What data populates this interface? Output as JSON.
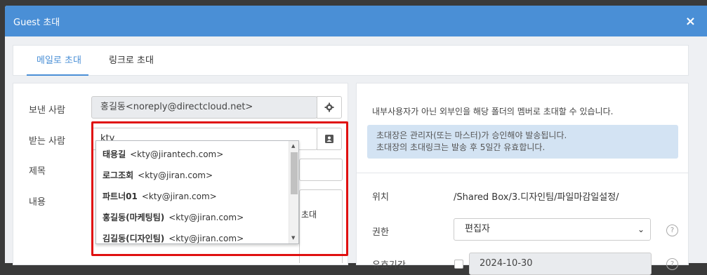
{
  "modal": {
    "title": "Guest 초대",
    "close_icon": "×"
  },
  "tabs": [
    {
      "label": "메일로 초대",
      "active": true
    },
    {
      "label": "링크로 초대",
      "active": false
    }
  ],
  "form": {
    "sender_label": "보낸 사람",
    "sender_value": "홍길동<noreply@directcloud.net>",
    "recipient_label": "받는 사람",
    "recipient_value": "kty",
    "subject_label": "제목",
    "content_label": "내용",
    "content_partial": "초대"
  },
  "autocomplete": [
    {
      "name": "태용길",
      "email": "<kty@jirantech.com>"
    },
    {
      "name": "로그조회",
      "email": "<kty@jiran.com>"
    },
    {
      "name": "파트너01",
      "email": "<kty@jiran.com>"
    },
    {
      "name": "홍길동(마케팅팀)",
      "email": "<kty@jiran.com>"
    },
    {
      "name": "김길동(디자인팀)",
      "email": "<kty@jiran.com>"
    }
  ],
  "info": {
    "description": "내부사용자가 아닌 외부인을 해당 폴더의 멤버로 초대할 수 있습니다.",
    "notice_line1": "초대장은 관리자(또는 마스터)가 승인해야 발송됩니다.",
    "notice_line2": "초대장의 초대링크는 발송 후 5일간 유효합니다."
  },
  "details": {
    "location_label": "위치",
    "location_value": "/Shared Box/3.디자인팀/파일마감일설정/",
    "permission_label": "권한",
    "permission_value": "편집자",
    "expiry_label": "유효기간",
    "expiry_value": "2024-10-30",
    "help_icon": "?"
  },
  "colors": {
    "header": "#4a8fd6",
    "accent": "#4a8fd6",
    "highlight": "#e01010",
    "notice_bg": "#d3e3f3"
  }
}
